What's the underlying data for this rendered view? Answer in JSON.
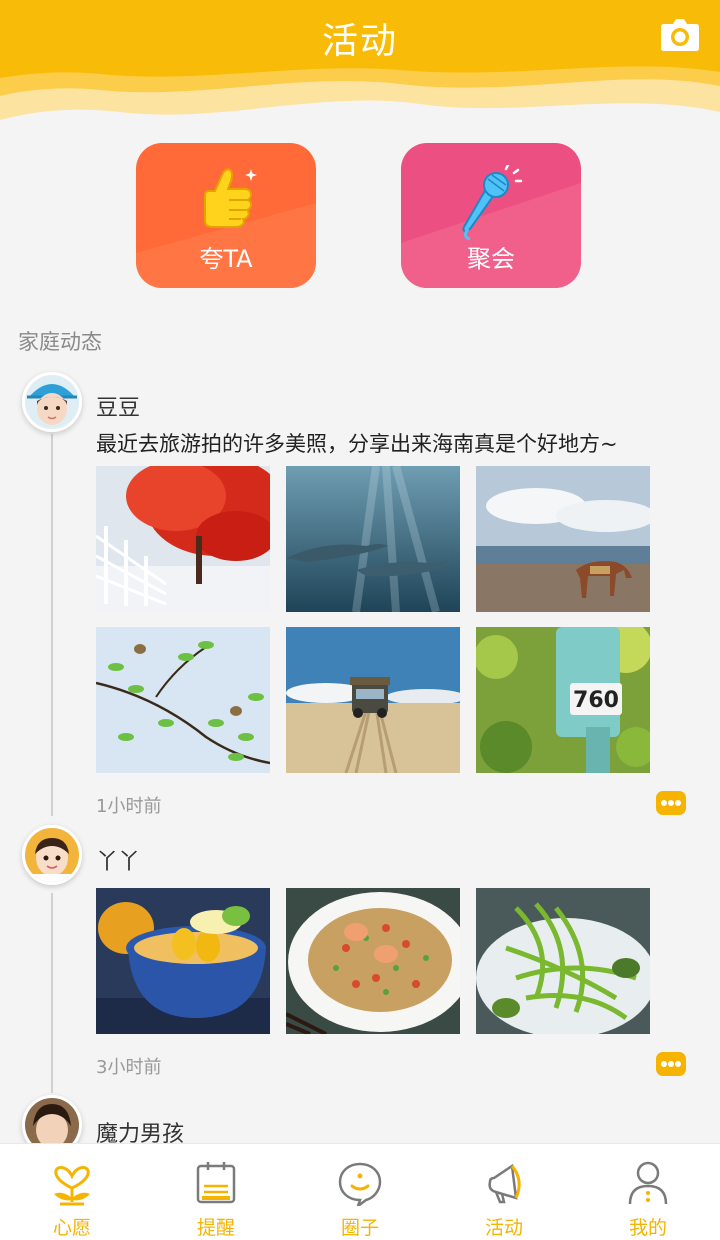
{
  "header": {
    "title": "活动",
    "camera_icon": "camera-icon"
  },
  "actions": [
    {
      "label": "夸TA",
      "icon": "thumbs-up-icon",
      "color": "#ff6a38"
    },
    {
      "label": "聚会",
      "icon": "microphone-icon",
      "color": "#ec4f82"
    }
  ],
  "section_label": "家庭动态",
  "posts": [
    {
      "user": "豆豆",
      "text": "最近去旅游拍的许多美照，分享出来海南真是个好地方~",
      "photos": [
        "red-tree-winter-photo",
        "dolphins-underwater-photo",
        "horse-beach-photo",
        "birds-branch-photo",
        "jeep-desert-photo",
        "mailbox-photo"
      ],
      "mailbox_number": "760",
      "time": "1小时前"
    },
    {
      "user": "丫丫",
      "text": "",
      "photos": [
        "lemon-dessert-photo",
        "fried-rice-photo",
        "green-noodles-photo"
      ],
      "time": "3小时前"
    },
    {
      "user": "魔力男孩"
    }
  ],
  "nav": [
    {
      "label": "心愿",
      "icon": "wish-icon"
    },
    {
      "label": "提醒",
      "icon": "reminder-icon"
    },
    {
      "label": "圈子",
      "icon": "circle-chat-icon"
    },
    {
      "label": "活动",
      "icon": "megaphone-icon"
    },
    {
      "label": "我的",
      "icon": "profile-icon"
    }
  ],
  "colors": {
    "brand_yellow": "#f6b400",
    "praise_orange": "#ff6a38",
    "party_pink": "#ec4f82"
  }
}
